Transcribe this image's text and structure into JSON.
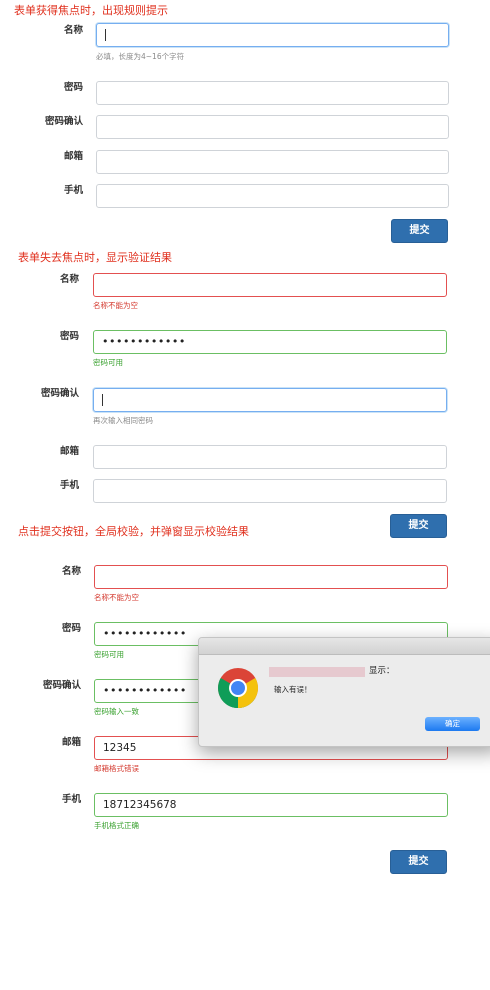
{
  "sections": [
    {
      "heading": "表单获得焦点时，出现规则提示",
      "fields": [
        {
          "label": "名称",
          "value": "",
          "hint": "必填，长度为4~16个字符"
        },
        {
          "label": "密码",
          "value": ""
        },
        {
          "label": "密码确认",
          "value": ""
        },
        {
          "label": "邮箱",
          "value": ""
        },
        {
          "label": "手机",
          "value": ""
        }
      ],
      "submit": "提交"
    },
    {
      "heading": "表单失去焦点时，显示验证结果",
      "fields": [
        {
          "label": "名称",
          "value": "",
          "hint": "名称不能为空"
        },
        {
          "label": "密码",
          "value": "••••••••••••",
          "hint": "密码可用"
        },
        {
          "label": "密码确认",
          "value": "",
          "hint": "再次输入相同密码"
        },
        {
          "label": "邮箱",
          "value": ""
        },
        {
          "label": "手机",
          "value": ""
        }
      ],
      "submit": "提交"
    },
    {
      "heading": "点击提交按钮，全局校验，并弹窗显示校验结果",
      "fields": [
        {
          "label": "名称",
          "value": "",
          "hint": "名称不能为空"
        },
        {
          "label": "密码",
          "value": "••••••••••••",
          "hint": "密码可用"
        },
        {
          "label": "密码确认",
          "value": "••••••••••••",
          "hint": "密码输入一致"
        },
        {
          "label": "邮箱",
          "value": "12345",
          "hint": "邮箱格式错误"
        },
        {
          "label": "手机",
          "value": "18712345678",
          "hint": "手机格式正确"
        }
      ],
      "submit": "提交"
    }
  ],
  "dialog": {
    "title": "显示：",
    "message": "输入有误！",
    "ok_label": "确定"
  },
  "colors": {
    "heading": "#e0301e",
    "error": "#e35050",
    "success": "#6bbf63",
    "focus": "#76aef0",
    "button": "#2f6fae"
  }
}
